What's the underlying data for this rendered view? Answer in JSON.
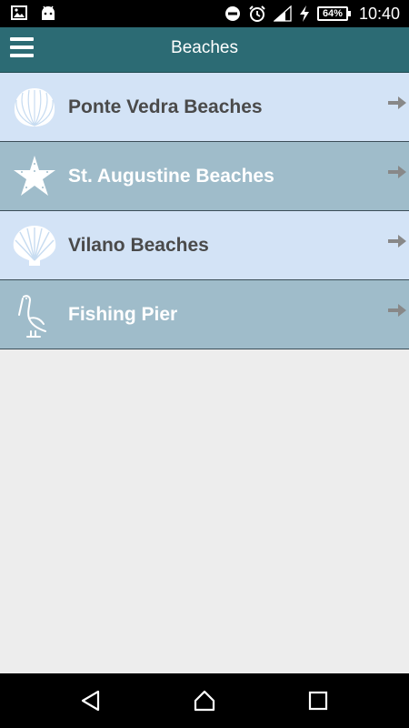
{
  "status_bar": {
    "battery_level": "64%",
    "time": "10:40",
    "left_icons": [
      "gallery-icon",
      "android-icon"
    ],
    "right_icons": [
      "do-not-disturb-icon",
      "alarm-icon",
      "signal-icon",
      "charging-icon"
    ]
  },
  "app_bar": {
    "title": "Beaches",
    "background_color": "#2c6b74"
  },
  "list": {
    "items": [
      {
        "label": "Ponte Vedra Beaches",
        "icon": "cockle-shell-icon",
        "style": "light"
      },
      {
        "label": "St. Augustine Beaches",
        "icon": "starfish-icon",
        "style": "dark"
      },
      {
        "label": "Vilano Beaches",
        "icon": "scallop-shell-icon",
        "style": "light"
      },
      {
        "label": "Fishing Pier",
        "icon": "pelican-icon",
        "style": "dark"
      }
    ],
    "light_color": "#d3e3f6",
    "dark_color": "#9fbcca",
    "arrow_icon": "arrow-right-icon"
  },
  "nav_bar": {
    "buttons": [
      "back-icon",
      "home-icon",
      "recents-icon"
    ]
  }
}
